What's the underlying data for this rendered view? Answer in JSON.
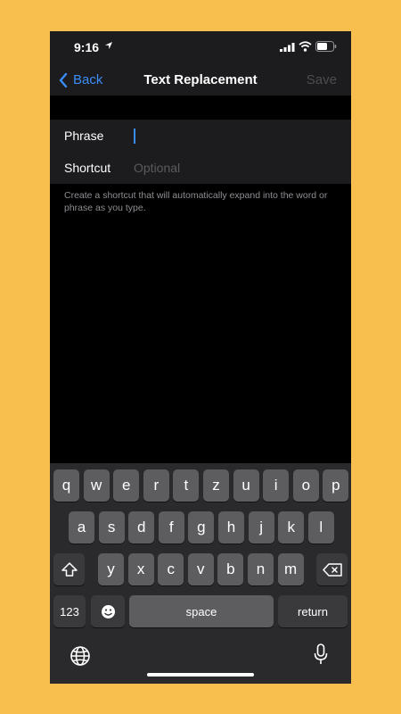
{
  "status": {
    "time": "9:16"
  },
  "nav": {
    "back": "Back",
    "title": "Text Replacement",
    "save": "Save"
  },
  "form": {
    "phrase_label": "Phrase",
    "phrase_value": "",
    "shortcut_label": "Shortcut",
    "shortcut_placeholder": "Optional",
    "footer": "Create a shortcut that will automatically expand into the word or phrase as you type."
  },
  "keyboard": {
    "row1": [
      "q",
      "w",
      "e",
      "r",
      "t",
      "z",
      "u",
      "i",
      "o",
      "p"
    ],
    "row2": [
      "a",
      "s",
      "d",
      "f",
      "g",
      "h",
      "j",
      "k",
      "l"
    ],
    "row3": [
      "y",
      "x",
      "c",
      "v",
      "b",
      "n",
      "m"
    ],
    "numbers": "123",
    "space": "space",
    "return": "return"
  },
  "colors": {
    "background": "#F8BE4E",
    "accent": "#3a8df6"
  }
}
